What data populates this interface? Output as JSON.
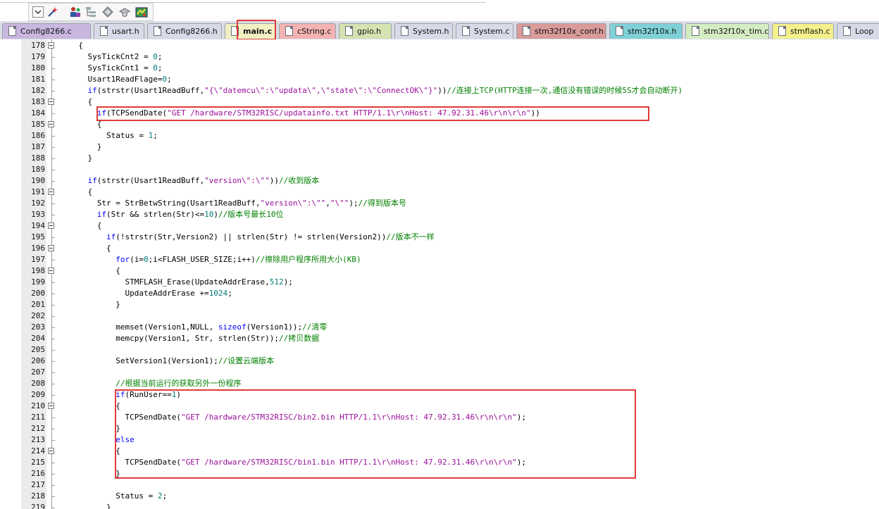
{
  "toolbar": {
    "icons": [
      "dropdown-arrow-icon",
      "wand-icon",
      "people-icon",
      "tree-icon",
      "diamond-icon",
      "cap-icon",
      "map-icon"
    ]
  },
  "tabs": [
    {
      "label": "Config8266.c",
      "color": "#c9b7e0"
    },
    {
      "label": "usart.h",
      "color": "#d7dbe8"
    },
    {
      "label": "Config8266.h",
      "color": "#d7dbe8"
    },
    {
      "label": "main.c",
      "color": "#f2f0c3",
      "active": true
    },
    {
      "label": "cString.c",
      "color": "#f4b3b3"
    },
    {
      "label": "gpio.h",
      "color": "#d4e3b1"
    },
    {
      "label": "System.h",
      "color": "#d7dbe8"
    },
    {
      "label": "System.c",
      "color": "#d7dbe8"
    },
    {
      "label": "stm32f10x_conf.h",
      "color": "#d99a9a"
    },
    {
      "label": "stm32f10x.h",
      "color": "#7fd1d7"
    },
    {
      "label": "stm32f10x_tim.c",
      "color": "#d4ecc2"
    },
    {
      "label": "stmflash.c",
      "color": "#f4f08c"
    },
    {
      "label": "Loop",
      "color": "#d7dbe8"
    }
  ],
  "lines": [
    {
      "num": "178",
      "fold": true,
      "segs": [
        {
          "t": "  {",
          "c": ""
        }
      ]
    },
    {
      "num": "179",
      "fold": false,
      "segs": [
        {
          "t": "    SysTickCnt2 = ",
          "c": ""
        },
        {
          "t": "0",
          "c": "num"
        },
        {
          "t": ";",
          "c": ""
        }
      ]
    },
    {
      "num": "180",
      "fold": false,
      "segs": [
        {
          "t": "    SysTickCnt1 = ",
          "c": ""
        },
        {
          "t": "0",
          "c": "num"
        },
        {
          "t": ";",
          "c": ""
        }
      ]
    },
    {
      "num": "181",
      "fold": false,
      "segs": [
        {
          "t": "    Usart1ReadFlage=",
          "c": ""
        },
        {
          "t": "0",
          "c": "num"
        },
        {
          "t": ";",
          "c": ""
        }
      ]
    },
    {
      "num": "182",
      "fold": false,
      "segs": [
        {
          "t": "    ",
          "c": ""
        },
        {
          "t": "if",
          "c": "kw"
        },
        {
          "t": "(strstr(Usart1ReadBuff,",
          "c": ""
        },
        {
          "t": "\"{\\\"datemcu\\\":\\\"updata\\\",\\\"state\\\":\\\"ConnectOK\\\"}\"",
          "c": "str"
        },
        {
          "t": "))",
          "c": ""
        },
        {
          "t": "//连接上TCP(HTTP连接一次,通信没有错误的时候5S才会自动断开)",
          "c": "cm"
        }
      ]
    },
    {
      "num": "183",
      "fold": true,
      "segs": [
        {
          "t": "    {",
          "c": ""
        }
      ]
    },
    {
      "num": "184",
      "fold": false,
      "segs": [
        {
          "t": "      ",
          "c": ""
        },
        {
          "t": "if",
          "c": "kw"
        },
        {
          "t": "(TCPSendDate(",
          "c": ""
        },
        {
          "t": "\"GET /hardware/STM32RISC/updatainfo.txt HTTP/1.1\\r\\nHost: 47.92.31.46\\r\\n\\r\\n\"",
          "c": "str"
        },
        {
          "t": "))",
          "c": ""
        }
      ]
    },
    {
      "num": "185",
      "fold": true,
      "segs": [
        {
          "t": "      {",
          "c": ""
        }
      ]
    },
    {
      "num": "186",
      "fold": false,
      "segs": [
        {
          "t": "        Status = ",
          "c": ""
        },
        {
          "t": "1",
          "c": "num"
        },
        {
          "t": ";",
          "c": ""
        }
      ]
    },
    {
      "num": "187",
      "fold": false,
      "segs": [
        {
          "t": "      }",
          "c": ""
        }
      ]
    },
    {
      "num": "188",
      "fold": false,
      "segs": [
        {
          "t": "    }",
          "c": ""
        }
      ]
    },
    {
      "num": "189",
      "fold": false,
      "segs": []
    },
    {
      "num": "190",
      "fold": false,
      "segs": [
        {
          "t": "    ",
          "c": ""
        },
        {
          "t": "if",
          "c": "kw"
        },
        {
          "t": "(strstr(Usart1ReadBuff,",
          "c": ""
        },
        {
          "t": "\"version\\\":\\\"\"",
          "c": "str"
        },
        {
          "t": "))",
          "c": ""
        },
        {
          "t": "//收到版本",
          "c": "cm"
        }
      ]
    },
    {
      "num": "191",
      "fold": true,
      "segs": [
        {
          "t": "    {",
          "c": ""
        }
      ]
    },
    {
      "num": "192",
      "fold": false,
      "segs": [
        {
          "t": "      Str = StrBetwString(Usart1ReadBuff,",
          "c": ""
        },
        {
          "t": "\"version\\\":\\\"\"",
          "c": "str"
        },
        {
          "t": ",",
          "c": ""
        },
        {
          "t": "\"\\\"\"",
          "c": "str"
        },
        {
          "t": ");",
          "c": ""
        },
        {
          "t": "//得到版本号",
          "c": "cm"
        }
      ]
    },
    {
      "num": "193",
      "fold": false,
      "segs": [
        {
          "t": "      ",
          "c": ""
        },
        {
          "t": "if",
          "c": "kw"
        },
        {
          "t": "(Str && strlen(Str)<=",
          "c": ""
        },
        {
          "t": "10",
          "c": "num"
        },
        {
          "t": ")",
          "c": ""
        },
        {
          "t": "//版本号最长10位",
          "c": "cm"
        }
      ]
    },
    {
      "num": "194",
      "fold": true,
      "segs": [
        {
          "t": "      {",
          "c": ""
        }
      ]
    },
    {
      "num": "195",
      "fold": false,
      "segs": [
        {
          "t": "        ",
          "c": ""
        },
        {
          "t": "if",
          "c": "kw"
        },
        {
          "t": "(!strstr(Str,Version2) || strlen(Str) != strlen(Version2))",
          "c": ""
        },
        {
          "t": "//版本不一样",
          "c": "cm"
        }
      ]
    },
    {
      "num": "196",
      "fold": true,
      "segs": [
        {
          "t": "        {",
          "c": ""
        }
      ]
    },
    {
      "num": "197",
      "fold": false,
      "segs": [
        {
          "t": "          ",
          "c": ""
        },
        {
          "t": "for",
          "c": "kw"
        },
        {
          "t": "(i=",
          "c": ""
        },
        {
          "t": "0",
          "c": "num"
        },
        {
          "t": ";i<FLASH_USER_SIZE;i++)",
          "c": ""
        },
        {
          "t": "//擦除用户程序所用大小(KB)",
          "c": "cm"
        }
      ]
    },
    {
      "num": "198",
      "fold": true,
      "segs": [
        {
          "t": "          {",
          "c": ""
        }
      ]
    },
    {
      "num": "199",
      "fold": false,
      "segs": [
        {
          "t": "            STMFLASH_Erase(UpdateAddrErase,",
          "c": ""
        },
        {
          "t": "512",
          "c": "num"
        },
        {
          "t": ");",
          "c": ""
        }
      ]
    },
    {
      "num": "200",
      "fold": false,
      "segs": [
        {
          "t": "            UpdateAddrErase +=",
          "c": ""
        },
        {
          "t": "1024",
          "c": "num"
        },
        {
          "t": ";",
          "c": ""
        }
      ]
    },
    {
      "num": "201",
      "fold": false,
      "segs": [
        {
          "t": "          }",
          "c": ""
        }
      ]
    },
    {
      "num": "202",
      "fold": false,
      "segs": []
    },
    {
      "num": "203",
      "fold": false,
      "segs": [
        {
          "t": "          memset(Version1,NULL, ",
          "c": ""
        },
        {
          "t": "sizeof",
          "c": "kw"
        },
        {
          "t": "(Version1));",
          "c": ""
        },
        {
          "t": "//清零",
          "c": "cm"
        }
      ]
    },
    {
      "num": "204",
      "fold": false,
      "segs": [
        {
          "t": "          memcpy(Version1, Str, strlen(Str));",
          "c": ""
        },
        {
          "t": "//拷贝数据",
          "c": "cm"
        }
      ]
    },
    {
      "num": "205",
      "fold": false,
      "segs": []
    },
    {
      "num": "206",
      "fold": false,
      "segs": [
        {
          "t": "          SetVersion1(Version1);",
          "c": ""
        },
        {
          "t": "//设置云端版本",
          "c": "cm"
        }
      ]
    },
    {
      "num": "207",
      "fold": false,
      "segs": []
    },
    {
      "num": "208",
      "fold": false,
      "segs": [
        {
          "t": "          ",
          "c": ""
        },
        {
          "t": "//根据当前运行的获取另外一份程序",
          "c": "cm"
        }
      ]
    },
    {
      "num": "209",
      "fold": false,
      "segs": [
        {
          "t": "          ",
          "c": ""
        },
        {
          "t": "if",
          "c": "kw"
        },
        {
          "t": "(RunUser==",
          "c": ""
        },
        {
          "t": "1",
          "c": "num"
        },
        {
          "t": ")",
          "c": ""
        }
      ]
    },
    {
      "num": "210",
      "fold": true,
      "segs": [
        {
          "t": "          {",
          "c": ""
        }
      ]
    },
    {
      "num": "211",
      "fold": false,
      "segs": [
        {
          "t": "            TCPSendDate(",
          "c": ""
        },
        {
          "t": "\"GET /hardware/STM32RISC/bin2.bin HTTP/1.1\\r\\nHost: 47.92.31.46\\r\\n\\r\\n\"",
          "c": "str"
        },
        {
          "t": ");",
          "c": ""
        }
      ]
    },
    {
      "num": "212",
      "fold": false,
      "segs": [
        {
          "t": "          }",
          "c": ""
        }
      ]
    },
    {
      "num": "213",
      "fold": false,
      "segs": [
        {
          "t": "          ",
          "c": ""
        },
        {
          "t": "else",
          "c": "kw"
        }
      ]
    },
    {
      "num": "214",
      "fold": true,
      "segs": [
        {
          "t": "          {",
          "c": ""
        }
      ]
    },
    {
      "num": "215",
      "fold": false,
      "segs": [
        {
          "t": "            TCPSendDate(",
          "c": ""
        },
        {
          "t": "\"GET /hardware/STM32RISC/bin1.bin HTTP/1.1\\r\\nHost: 47.92.31.46\\r\\n\\r\\n\"",
          "c": "str"
        },
        {
          "t": ");",
          "c": ""
        }
      ]
    },
    {
      "num": "216",
      "fold": false,
      "segs": [
        {
          "t": "          }",
          "c": ""
        }
      ]
    },
    {
      "num": "217",
      "fold": false,
      "segs": []
    },
    {
      "num": "218",
      "fold": false,
      "segs": [
        {
          "t": "          Status = ",
          "c": ""
        },
        {
          "t": "2",
          "c": "num"
        },
        {
          "t": ";",
          "c": ""
        }
      ]
    },
    {
      "num": "219",
      "fold": false,
      "segs": [
        {
          "t": "        }",
          "c": ""
        }
      ]
    }
  ]
}
